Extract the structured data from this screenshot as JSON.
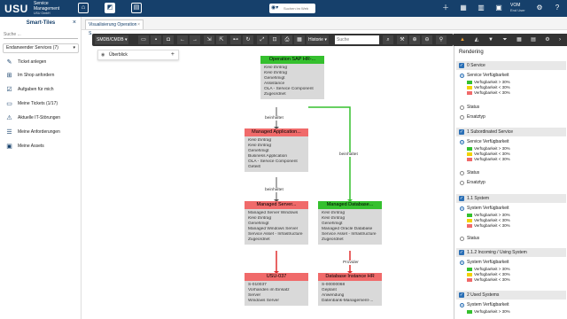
{
  "header": {
    "brand": "USU",
    "brand_line1": "Service",
    "brand_line2": "Management",
    "brand_line3": "USU GmbH",
    "search_placeholder": "Suchen im Web",
    "user_name": "VOM",
    "user_role": "End User"
  },
  "sidebar": {
    "title": "Smart-Tiles",
    "search_placeholder": "Suche ...",
    "dropdown": "Endanwender Services (7)",
    "items": [
      {
        "label": "Ticket anlegen",
        "icon": "ticket-icon"
      },
      {
        "label": "Im Shop anfordern",
        "icon": "cart-icon"
      },
      {
        "label": "Aufgaben für mich",
        "icon": "tasks-icon"
      },
      {
        "label": "Meine Tickets (1/17)",
        "icon": "tickets-icon"
      },
      {
        "label": "Aktuelle IT-Störungen",
        "icon": "alert-icon"
      },
      {
        "label": "Meine Anforderungen",
        "icon": "requests-icon"
      },
      {
        "label": "Meine Assets",
        "icon": "assets-icon"
      }
    ]
  },
  "tabs": [
    {
      "label": "Visualisierung Operation S..."
    }
  ],
  "toolbar": {
    "view_select": "SMDB/CMDB",
    "history_label": "Historie",
    "search_placeholder": "Suche"
  },
  "overview": {
    "label": "Überblick"
  },
  "graph": {
    "nodes": [
      {
        "id": "op",
        "title": "Operation SAP HR-...",
        "color": "green",
        "lines": [
          {
            "t": "Kein Eintrag",
            "i": true
          },
          {
            "t": "Kein Eintrag",
            "i": true
          },
          {
            "t": "Genehmigt"
          },
          {
            "t": "Assistance"
          },
          {
            "t": "OLA - Service Component"
          },
          {
            "t": "Zugeordnet"
          }
        ]
      },
      {
        "id": "app",
        "title": "Managed Application...",
        "color": "red",
        "lines": [
          {
            "t": "Kein Eintrag",
            "i": true
          },
          {
            "t": "Kein Eintrag",
            "i": true
          },
          {
            "t": "Genehmigt"
          },
          {
            "t": "Business Application"
          },
          {
            "t": "OLA - Service Component"
          },
          {
            "t": "Geteilt"
          }
        ]
      },
      {
        "id": "srv",
        "title": "Managed Server...",
        "color": "red",
        "lines": [
          {
            "t": "Managed Server Windows"
          },
          {
            "t": "Kein Eintrag",
            "i": true
          },
          {
            "t": "Genehmigt"
          },
          {
            "t": "Managed Windows Server"
          },
          {
            "t": "Service Asset - Infrastructure"
          },
          {
            "t": "Zugeordnet"
          }
        ]
      },
      {
        "id": "db",
        "title": "Managed Database...",
        "color": "green",
        "lines": [
          {
            "t": "Kein Eintrag",
            "i": true
          },
          {
            "t": "Kein Eintrag",
            "i": true
          },
          {
            "t": "Genehmigt"
          },
          {
            "t": "Managed Oracle Database"
          },
          {
            "t": "Service Asset - Infrastructure"
          },
          {
            "t": "Zugeordnet"
          }
        ]
      },
      {
        "id": "usu",
        "title": "USU-037",
        "color": "red",
        "lines": [
          {
            "t": "S-010037"
          },
          {
            "t": "Vorhanden im Einsatz"
          },
          {
            "t": "Server"
          },
          {
            "t": "Windows Server"
          }
        ]
      },
      {
        "id": "dbi",
        "title": "Database Instance HR",
        "color": "red",
        "lines": [
          {
            "t": "S-00000068"
          },
          {
            "t": "Geplant"
          },
          {
            "t": "Anwendung"
          },
          {
            "t": "Datenbank-Management-..."
          }
        ]
      }
    ],
    "edge_labels": {
      "e1": "beinhaltet",
      "e2": "beinhaltet",
      "e3": "beinhaltet",
      "e4": "Provider"
    }
  },
  "rendering": {
    "title": "Rendering",
    "sections": [
      {
        "label": "0 Service",
        "radios": [
          {
            "label": "Service Verfügbarkeit",
            "on": true
          },
          {
            "label": "Status"
          },
          {
            "label": "Ersatztyp"
          }
        ]
      },
      {
        "label": "1 Subordinated Service",
        "radios": [
          {
            "label": "Service Verfügbarkeit",
            "on": true
          },
          {
            "label": "Status"
          },
          {
            "label": "Ersatztyp"
          }
        ]
      },
      {
        "label": "1.1 System",
        "radios": [
          {
            "label": "System Verfügbarkeit",
            "on": true
          },
          {
            "label": "Status"
          }
        ]
      },
      {
        "label": "1.1.2 Incoming / Using System",
        "radios": [
          {
            "label": "System Verfügbarkeit",
            "on": true
          }
        ]
      },
      {
        "label": "2 Used Systems",
        "radios": [
          {
            "label": "System Verfügbarkeit",
            "on": true
          }
        ]
      }
    ],
    "legend": [
      {
        "label": "Verfügbarkeit > 30%",
        "color": "#35c02e"
      },
      {
        "label": "Verfügbarkeit < 30%",
        "color": "#f2d200"
      },
      {
        "label": "Verfügbarkeit < 30%",
        "color": "#f06a6a"
      }
    ]
  }
}
